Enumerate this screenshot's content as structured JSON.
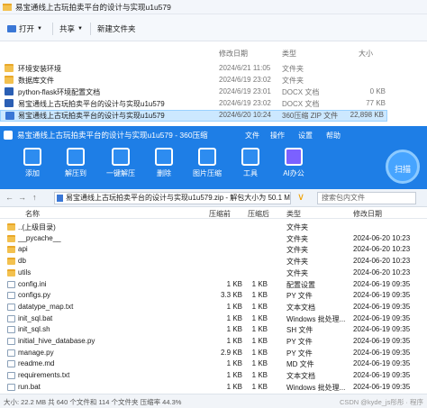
{
  "explorer": {
    "title": "易宝通线上古玩拍卖平台的设计与实现u1u579",
    "toolbar": {
      "open": "打开",
      "share": "共享",
      "new_folder": "新建文件夹"
    },
    "columns": {
      "modified": "修改日期",
      "type": "类型",
      "size": "大小"
    },
    "rows": [
      {
        "name": "环境安装环境",
        "date": "2024/6/21 11:05",
        "type": "文件夹",
        "size": ""
      },
      {
        "name": "数据库文件",
        "date": "2024/6/19 23:02",
        "type": "文件夹",
        "size": ""
      },
      {
        "name": "python-flask环境配置文档",
        "date": "2024/6/19 23:01",
        "type": "DOCX 文档",
        "size": "0 KB"
      },
      {
        "name": "易宝通线上古玩拍卖平台的设计与实现u1u579",
        "date": "2024/6/19 23:02",
        "type": "DOCX 文档",
        "size": "77 KB"
      },
      {
        "name": "易宝通线上古玩拍卖平台的设计与实现u1u579",
        "date": "2024/6/20 10:24",
        "type": "360压缩 ZIP 文件",
        "size": "22,898 KB"
      }
    ]
  },
  "zip": {
    "title": "易宝通线上古玩拍卖平台的设计与实现u1u579 - 360压缩",
    "menu": {
      "file": "文件",
      "operation": "操作",
      "settings": "设置",
      "help": "帮助"
    },
    "tools": [
      "添加",
      "解压到",
      "一键解压",
      "删除",
      "图片压缩",
      "工具",
      "AI办公"
    ],
    "scan_label": "扫描",
    "path": "易宝通线上古玩拍卖平台的设计与实现u1u579.zip - 解包大小为 50.1 MB",
    "search_placeholder": "搜索包内文件",
    "columns": {
      "name": "名称",
      "compressed": "压缩前",
      "after": "压缩后",
      "type": "类型",
      "modified": "修改日期"
    },
    "rows": [
      {
        "name": "..(上级目录)",
        "before": "",
        "after": "",
        "type": "文件夹",
        "date": ""
      },
      {
        "name": "__pycache__",
        "before": "",
        "after": "",
        "type": "文件夹",
        "date": "2024-06-20 10:23"
      },
      {
        "name": "api",
        "before": "",
        "after": "",
        "type": "文件夹",
        "date": "2024-06-20 10:23"
      },
      {
        "name": "db",
        "before": "",
        "after": "",
        "type": "文件夹",
        "date": "2024-06-20 10:23"
      },
      {
        "name": "utils",
        "before": "",
        "after": "",
        "type": "文件夹",
        "date": "2024-06-20 10:23"
      },
      {
        "name": "config.ini",
        "before": "1 KB",
        "after": "1 KB",
        "type": "配置设置",
        "date": "2024-06-19 09:35"
      },
      {
        "name": "configs.py",
        "before": "3.3 KB",
        "after": "1 KB",
        "type": "PY 文件",
        "date": "2024-06-19 09:35"
      },
      {
        "name": "datatype_map.txt",
        "before": "1 KB",
        "after": "1 KB",
        "type": "文本文档",
        "date": "2024-06-19 09:35"
      },
      {
        "name": "init_sql.bat",
        "before": "1 KB",
        "after": "1 KB",
        "type": "Windows 批处理...",
        "date": "2024-06-19 09:35"
      },
      {
        "name": "init_sql.sh",
        "before": "1 KB",
        "after": "1 KB",
        "type": "SH 文件",
        "date": "2024-06-19 09:35"
      },
      {
        "name": "initial_hive_database.py",
        "before": "1 KB",
        "after": "1 KB",
        "type": "PY 文件",
        "date": "2024-06-19 09:35"
      },
      {
        "name": "manage.py",
        "before": "2.9 KB",
        "after": "1 KB",
        "type": "PY 文件",
        "date": "2024-06-19 09:35"
      },
      {
        "name": "readme.md",
        "before": "1 KB",
        "after": "1 KB",
        "type": "MD 文件",
        "date": "2024-06-19 09:35"
      },
      {
        "name": "requirements.txt",
        "before": "1 KB",
        "after": "1 KB",
        "type": "文本文档",
        "date": "2024-06-19 09:35"
      },
      {
        "name": "run.bat",
        "before": "1 KB",
        "after": "1 KB",
        "type": "Windows 批处理...",
        "date": "2024-06-19 09:35"
      }
    ],
    "status": "大小: 22.2 MB 共 640 个文件和 114 个文件夹 压缩率 44.3%",
    "watermark": "CSDN @kyde_js彤彤 · 程序"
  },
  "colors": {
    "accent": "#1e7ee6",
    "selection": "#cce8ff"
  }
}
